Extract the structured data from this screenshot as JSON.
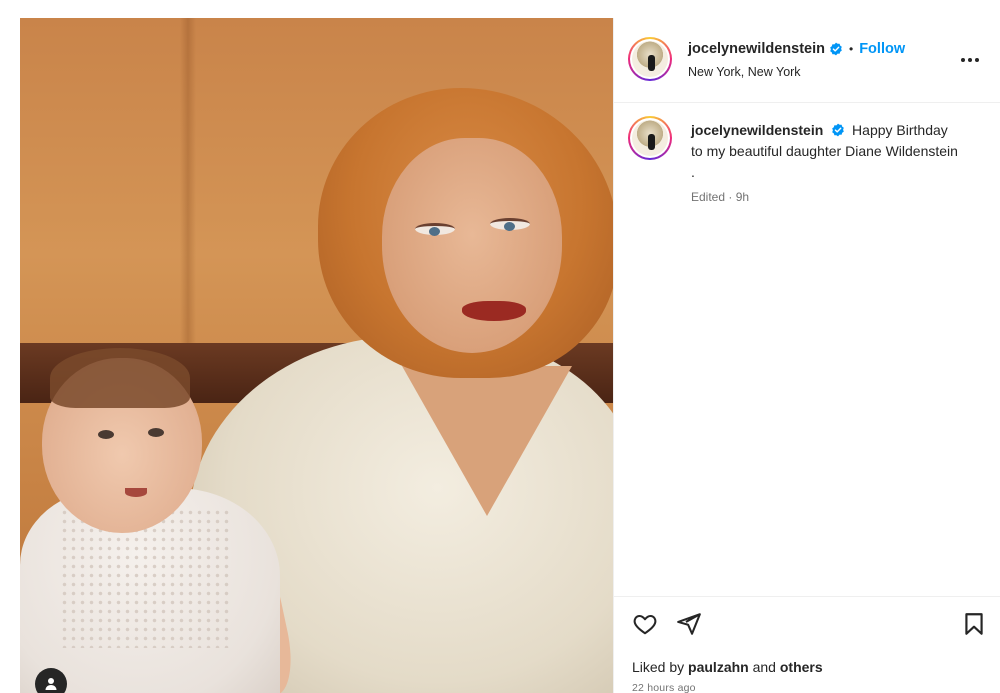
{
  "post": {
    "username": "jocelynewildenstein",
    "follow_label": "Follow",
    "separator": "•",
    "location": "New York, New York",
    "more_icon": "more-horizontal-icon",
    "verified_icon": "verified-badge-icon",
    "accent_color": "#0095f6",
    "verified_color": "#0095f6"
  },
  "caption": {
    "username": "jocelynewildenstein",
    "text": "Happy Birthday to my beautiful daughter Diane Wildenstein .",
    "meta": "Edited · 9h"
  },
  "footer": {
    "icons": [
      "heart-icon",
      "share-icon",
      "bookmark-icon"
    ],
    "likes_prefix": "Liked by",
    "likes_user": "paulzahn",
    "likes_and": "and",
    "likes_others": "others",
    "timestamp": "22 hours ago"
  },
  "photo": {
    "tag_icon": "user-tag-icon"
  }
}
